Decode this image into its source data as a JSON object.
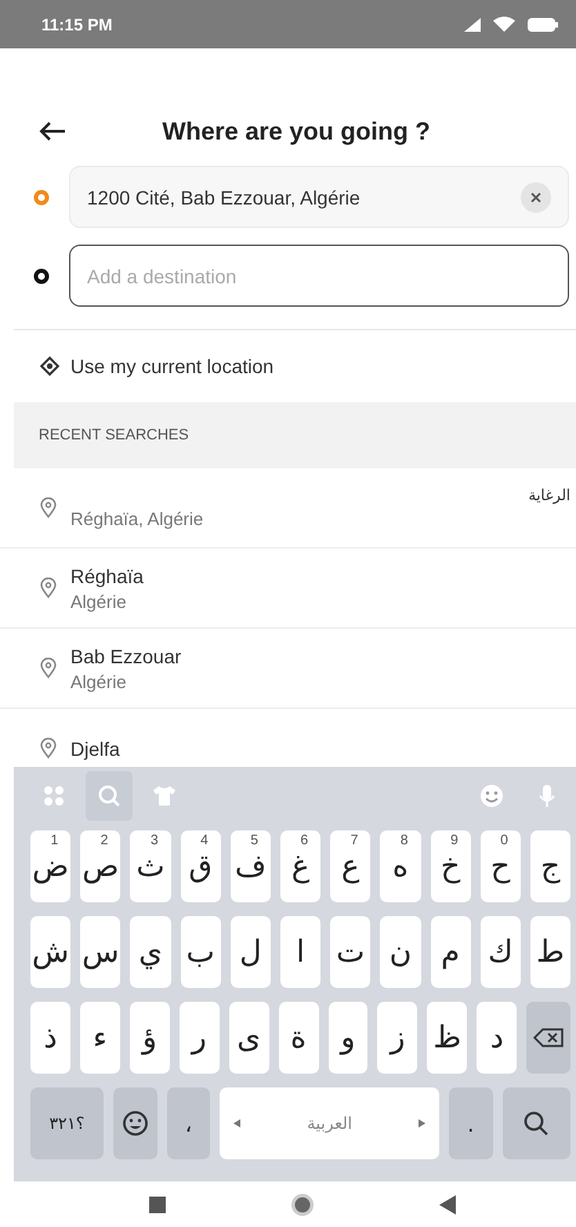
{
  "status_bar": {
    "time": "11:15 PM"
  },
  "header": {
    "title": "Where are you going ?"
  },
  "route": {
    "origin": {
      "value": "1200 Cité, Bab Ezzouar, Algérie"
    },
    "destination": {
      "placeholder": "Add a destination"
    }
  },
  "current_location": {
    "label": "Use my current location"
  },
  "recent_searches": {
    "heading": "RECENT SEARCHES",
    "items": [
      {
        "kind": "rtl",
        "title": "الرغاية",
        "subtitle": "Réghaïa, Algérie"
      },
      {
        "kind": "ltr",
        "title": "Réghaïa",
        "subtitle": "Algérie"
      },
      {
        "kind": "ltr",
        "title": "Bab Ezzouar",
        "subtitle": "Algérie"
      },
      {
        "kind": "ltr",
        "title": "Djelfa"
      }
    ]
  },
  "keyboard": {
    "rows": [
      [
        {
          "char": "ض",
          "hint": "1"
        },
        {
          "char": "ص",
          "hint": "2"
        },
        {
          "char": "ث",
          "hint": "3"
        },
        {
          "char": "ق",
          "hint": "4"
        },
        {
          "char": "ف",
          "hint": "5"
        },
        {
          "char": "غ",
          "hint": "6"
        },
        {
          "char": "ع",
          "hint": "7"
        },
        {
          "char": "ه",
          "hint": "8"
        },
        {
          "char": "خ",
          "hint": "9"
        },
        {
          "char": "ح",
          "hint": "0"
        },
        {
          "char": "ج"
        }
      ],
      [
        {
          "char": "ش"
        },
        {
          "char": "س"
        },
        {
          "char": "ي"
        },
        {
          "char": "ب"
        },
        {
          "char": "ل"
        },
        {
          "char": "ا"
        },
        {
          "char": "ت"
        },
        {
          "char": "ن"
        },
        {
          "char": "م"
        },
        {
          "char": "ك"
        },
        {
          "char": "ط"
        }
      ],
      [
        {
          "char": "ذ"
        },
        {
          "char": "ء"
        },
        {
          "char": "ؤ"
        },
        {
          "char": "ر"
        },
        {
          "char": "ى"
        },
        {
          "char": "ة"
        },
        {
          "char": "و"
        },
        {
          "char": "ز"
        },
        {
          "char": "ظ"
        },
        {
          "char": "د"
        }
      ]
    ],
    "symbols_key": "؟٣٢١",
    "comma_key": "،",
    "space_key": "العربية",
    "period_key": "."
  }
}
